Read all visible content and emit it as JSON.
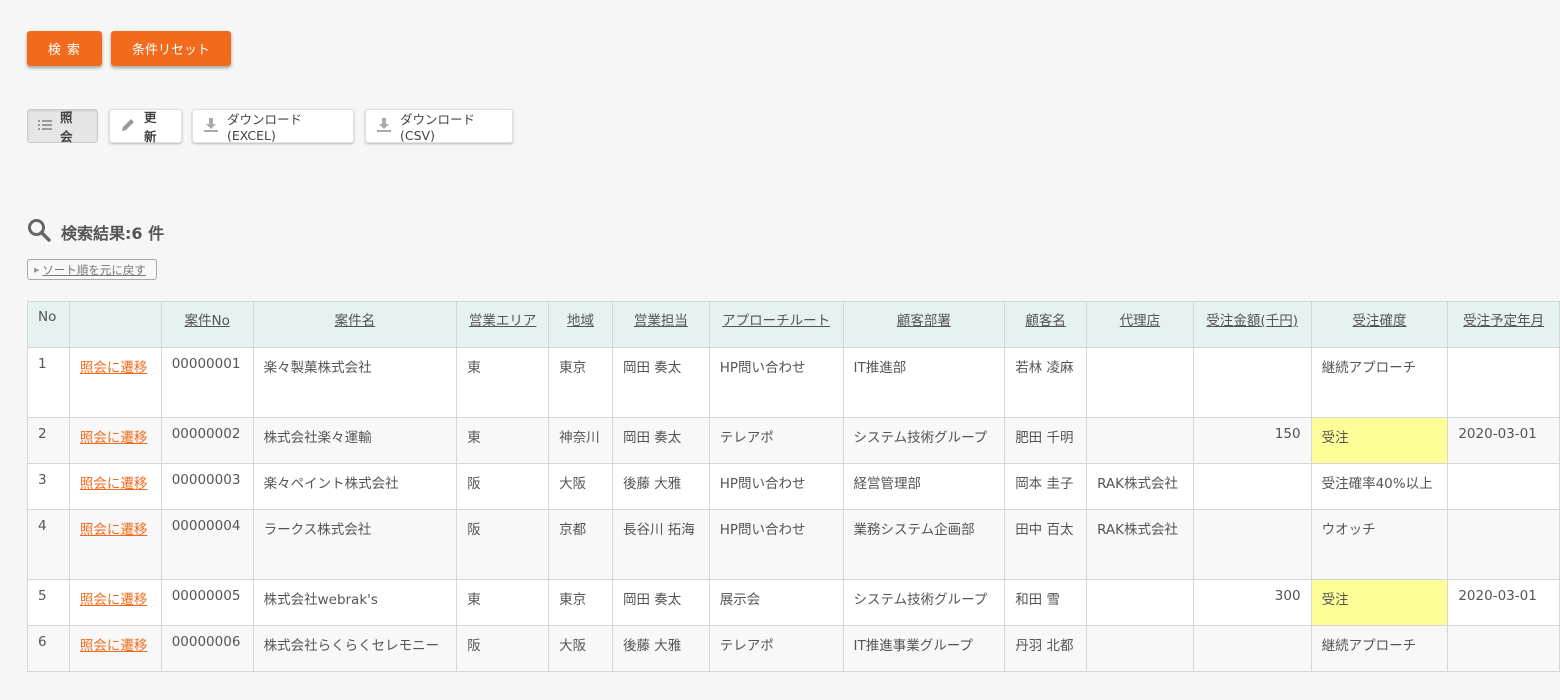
{
  "buttons": {
    "search": "検 索",
    "reset": "条件リセット"
  },
  "toolbar": {
    "view": "照 会",
    "update": "更 新",
    "download_excel": "ダウンロード(EXCEL)",
    "download_csv": "ダウンロード(CSV)"
  },
  "results": {
    "heading": "検索結果:6 件",
    "sort_reset": "ソート順を元に戻す"
  },
  "table": {
    "columns": [
      "No",
      "",
      "案件No",
      "案件名",
      "営業エリア",
      "地域",
      "営業担当",
      "アプローチルート",
      "顧客部署",
      "顧客名",
      "代理店",
      "受注金額(千円)",
      "受注確度",
      "受注予定年月"
    ],
    "rows": [
      [
        "1",
        "照会に遷移",
        "00000001",
        "楽々製菓株式会社",
        "東",
        "東京",
        "岡田 奏太",
        "HP問い合わせ",
        "IT推進部",
        "若林 凌麻",
        "",
        "",
        "継続アプローチ",
        ""
      ],
      [
        "2",
        "照会に遷移",
        "00000002",
        "株式会社楽々運輸",
        "東",
        "神奈川",
        "岡田 奏太",
        "テレアポ",
        "システム技術グループ",
        "肥田 千明",
        "",
        "150",
        "受注",
        "2020-03-01"
      ],
      [
        "3",
        "照会に遷移",
        "00000003",
        "楽々ペイント株式会社",
        "阪",
        "大阪",
        "後藤 大雅",
        "HP問い合わせ",
        "経営管理部",
        "岡本 圭子",
        "RAK株式会社",
        "",
        "受注確率40%以上",
        ""
      ],
      [
        "4",
        "照会に遷移",
        "00000004",
        "ラークス株式会社",
        "阪",
        "京都",
        "長谷川 拓海",
        "HP問い合わせ",
        "業務システム企画部",
        "田中 百太",
        "RAK株式会社",
        "",
        "ウオッチ",
        ""
      ],
      [
        "5",
        "照会に遷移",
        "00000005",
        "株式会社webrak's",
        "東",
        "東京",
        "岡田 奏太",
        "展示会",
        "システム技術グループ",
        "和田 雪",
        "",
        "300",
        "受注",
        "2020-03-01"
      ],
      [
        "6",
        "照会に遷移",
        "00000006",
        "株式会社らくらくセレモニー",
        "阪",
        "大阪",
        "後藤 大雅",
        "テレアポ",
        "IT推進事業グループ",
        "丹羽 北都",
        "",
        "",
        "継続アプローチ",
        ""
      ]
    ]
  },
  "colors": {
    "accent": "#f26b1d",
    "header_bg": "#e6f2f2",
    "highlight": "#ffff99"
  },
  "icons": {
    "view": "list-icon",
    "update": "pencil-icon",
    "download": "download-icon",
    "search": "magnifier-icon",
    "sort": "triangle-right-icon"
  }
}
